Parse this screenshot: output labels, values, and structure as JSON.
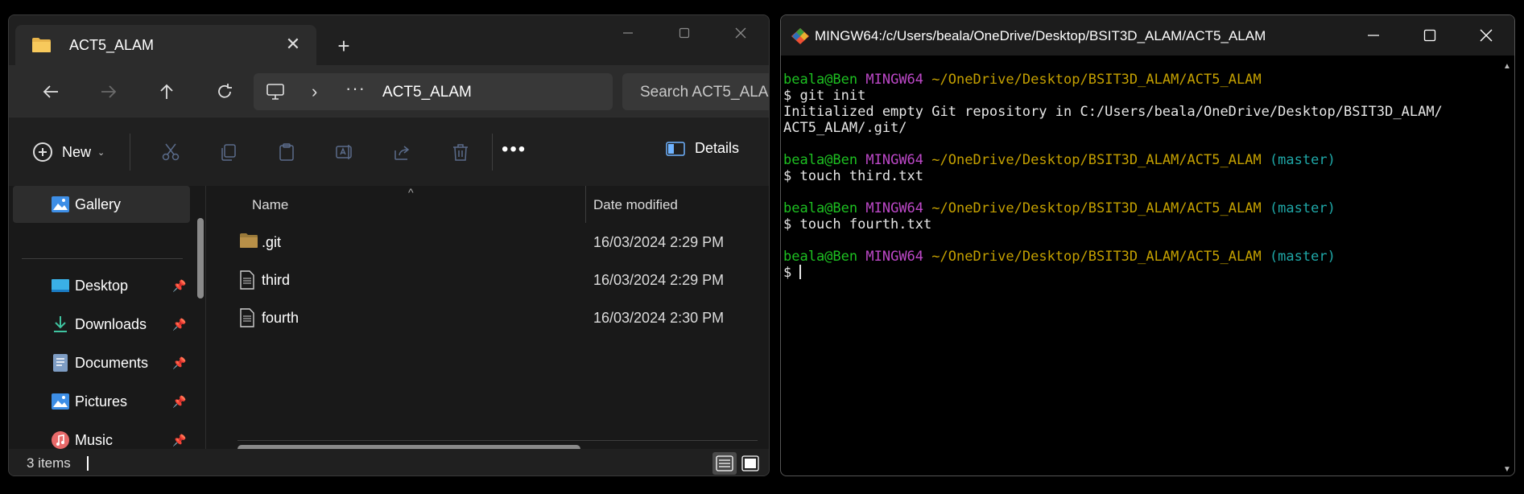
{
  "explorer": {
    "tab_title": "ACT5_ALAM",
    "new_tab_symbol": "+",
    "close_symbol": "✕",
    "address": {
      "ellipsis": "···",
      "path": "ACT5_ALAM"
    },
    "search_placeholder": "Search ACT5_ALA",
    "toolbar": {
      "new_label": "New",
      "more_label": "•••",
      "details_label": "Details"
    },
    "sidebar": {
      "gallery": "Gallery",
      "items": [
        {
          "label": "Desktop",
          "icon": "desktop-icon"
        },
        {
          "label": "Downloads",
          "icon": "download-icon"
        },
        {
          "label": "Documents",
          "icon": "documents-icon"
        },
        {
          "label": "Pictures",
          "icon": "pictures-icon"
        },
        {
          "label": "Music",
          "icon": "music-icon"
        }
      ]
    },
    "columns": {
      "name": "Name",
      "date_modified": "Date modified"
    },
    "files": [
      {
        "name": ".git",
        "type": "folder",
        "date": "16/03/2024 2:29 PM"
      },
      {
        "name": "third",
        "type": "file",
        "date": "16/03/2024 2:29 PM"
      },
      {
        "name": "fourth",
        "type": "file",
        "date": "16/03/2024 2:30 PM"
      }
    ],
    "status": "3 items"
  },
  "terminal": {
    "title": "MINGW64:/c/Users/beala/OneDrive/Desktop/BSIT3D_ALAM/ACT5_ALAM",
    "prompt": {
      "user_host": "beala@Ben",
      "system": "MINGW64",
      "path": "~/OneDrive/Desktop/BSIT3D_ALAM/ACT5_ALAM",
      "branch": "(master)"
    },
    "lines": {
      "cmd1": "$ git init",
      "out1a": "Initialized empty Git repository in C:/Users/beala/OneDrive/Desktop/BSIT3D_ALAM/",
      "out1b": "ACT5_ALAM/.git/",
      "cmd2": "$ touch third.txt",
      "cmd3": "$ touch fourth.txt",
      "cmd4": "$ "
    }
  },
  "colors": {
    "prompt_user": "#1dc121",
    "prompt_system": "#bd48c8",
    "prompt_path": "#c4a000",
    "prompt_branch": "#1fa8a8",
    "folder": "#e8b44a"
  }
}
